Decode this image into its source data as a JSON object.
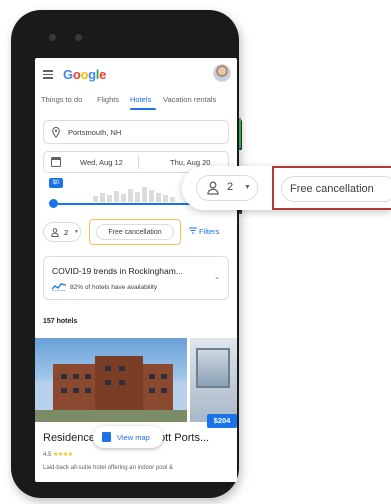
{
  "header": {
    "logo_letters": [
      {
        "char": "G",
        "color": "#4285f4"
      },
      {
        "char": "o",
        "color": "#ea4335"
      },
      {
        "char": "o",
        "color": "#fbbc04"
      },
      {
        "char": "g",
        "color": "#4285f4"
      },
      {
        "char": "l",
        "color": "#34a853"
      },
      {
        "char": "e",
        "color": "#ea4335"
      }
    ],
    "menu_icon": "hamburger-icon",
    "avatar": "user-avatar"
  },
  "tabs": [
    {
      "label": "Things to do",
      "active": false
    },
    {
      "label": "Flights",
      "active": false
    },
    {
      "label": "Hotels",
      "active": true
    },
    {
      "label": "Vacation rentals",
      "active": false
    }
  ],
  "search": {
    "location": "Portsmouth, NH",
    "check_in": "Wed, Aug 12",
    "check_out": "Thu, Aug 20"
  },
  "price_slider": {
    "min_label": "$0"
  },
  "filters": {
    "guests": "2",
    "free_cancellation": "Free cancellation",
    "filters_label": "Filters"
  },
  "covid": {
    "title": "COVID-19 trends in Rockingham...",
    "subtitle": "82% of hotels have availability"
  },
  "results": {
    "count": "157 hotels"
  },
  "hotel": {
    "name_start": "Residence",
    "name_end": "ott Ports...",
    "rating": "4.5",
    "stars": "★★★★",
    "price": "$204",
    "description": "Laid-back all-suite hotel offering an indoor pool &"
  },
  "map_button": {
    "label": "View map"
  },
  "callout": {
    "guests": "2",
    "free_cancellation": "Free cancellation"
  },
  "colors": {
    "accent": "#1a73e8",
    "highlight_border": "#f2c14e",
    "callout_border": "#b33a3a"
  }
}
